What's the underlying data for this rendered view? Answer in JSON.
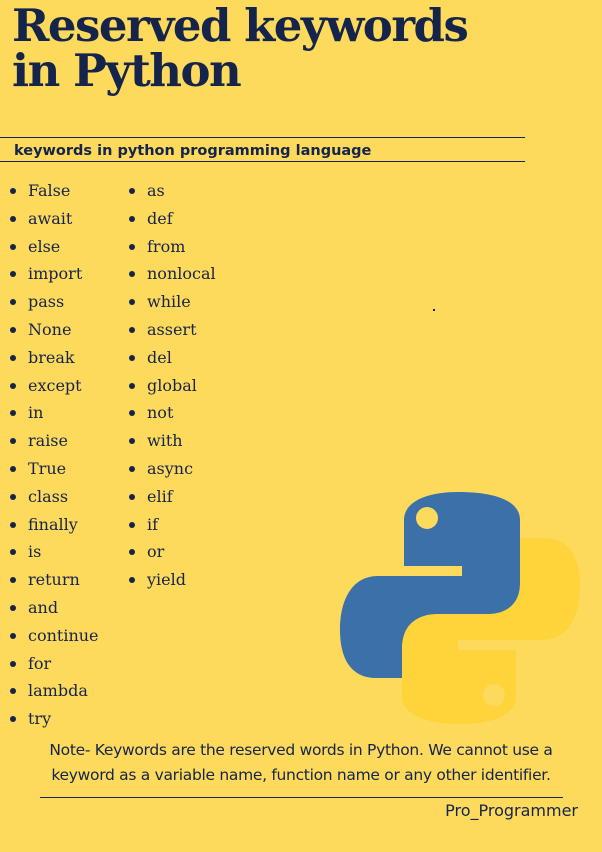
{
  "title": {
    "line1": "Reserved keywords",
    "line2": "in Python"
  },
  "subtitle": "keywords in python programming language",
  "keywords_column_1": [
    "False",
    "await",
    "else",
    "import",
    "pass",
    "None",
    "break",
    "except",
    "in",
    "raise",
    "True",
    "class",
    "finally",
    "is",
    "return",
    "and",
    "continue",
    "for",
    "lambda",
    "try"
  ],
  "keywords_column_2": [
    "as",
    "def",
    "from",
    "nonlocal",
    "while",
    "assert",
    "del",
    "global",
    "not",
    "with",
    "async",
    "elif",
    "if",
    "or",
    "yield"
  ],
  "note": "Note- Keywords are the reserved words in Python. We cannot use a keyword as a variable name, function name or any other identifier.",
  "author": "Pro_Programmer",
  "colors": {
    "background": "#fdd95c",
    "text": "#15244a",
    "python_blue": "#3b70a8",
    "python_yellow": "#ffd43b"
  },
  "icons": {
    "logo": "python-logo-icon"
  }
}
